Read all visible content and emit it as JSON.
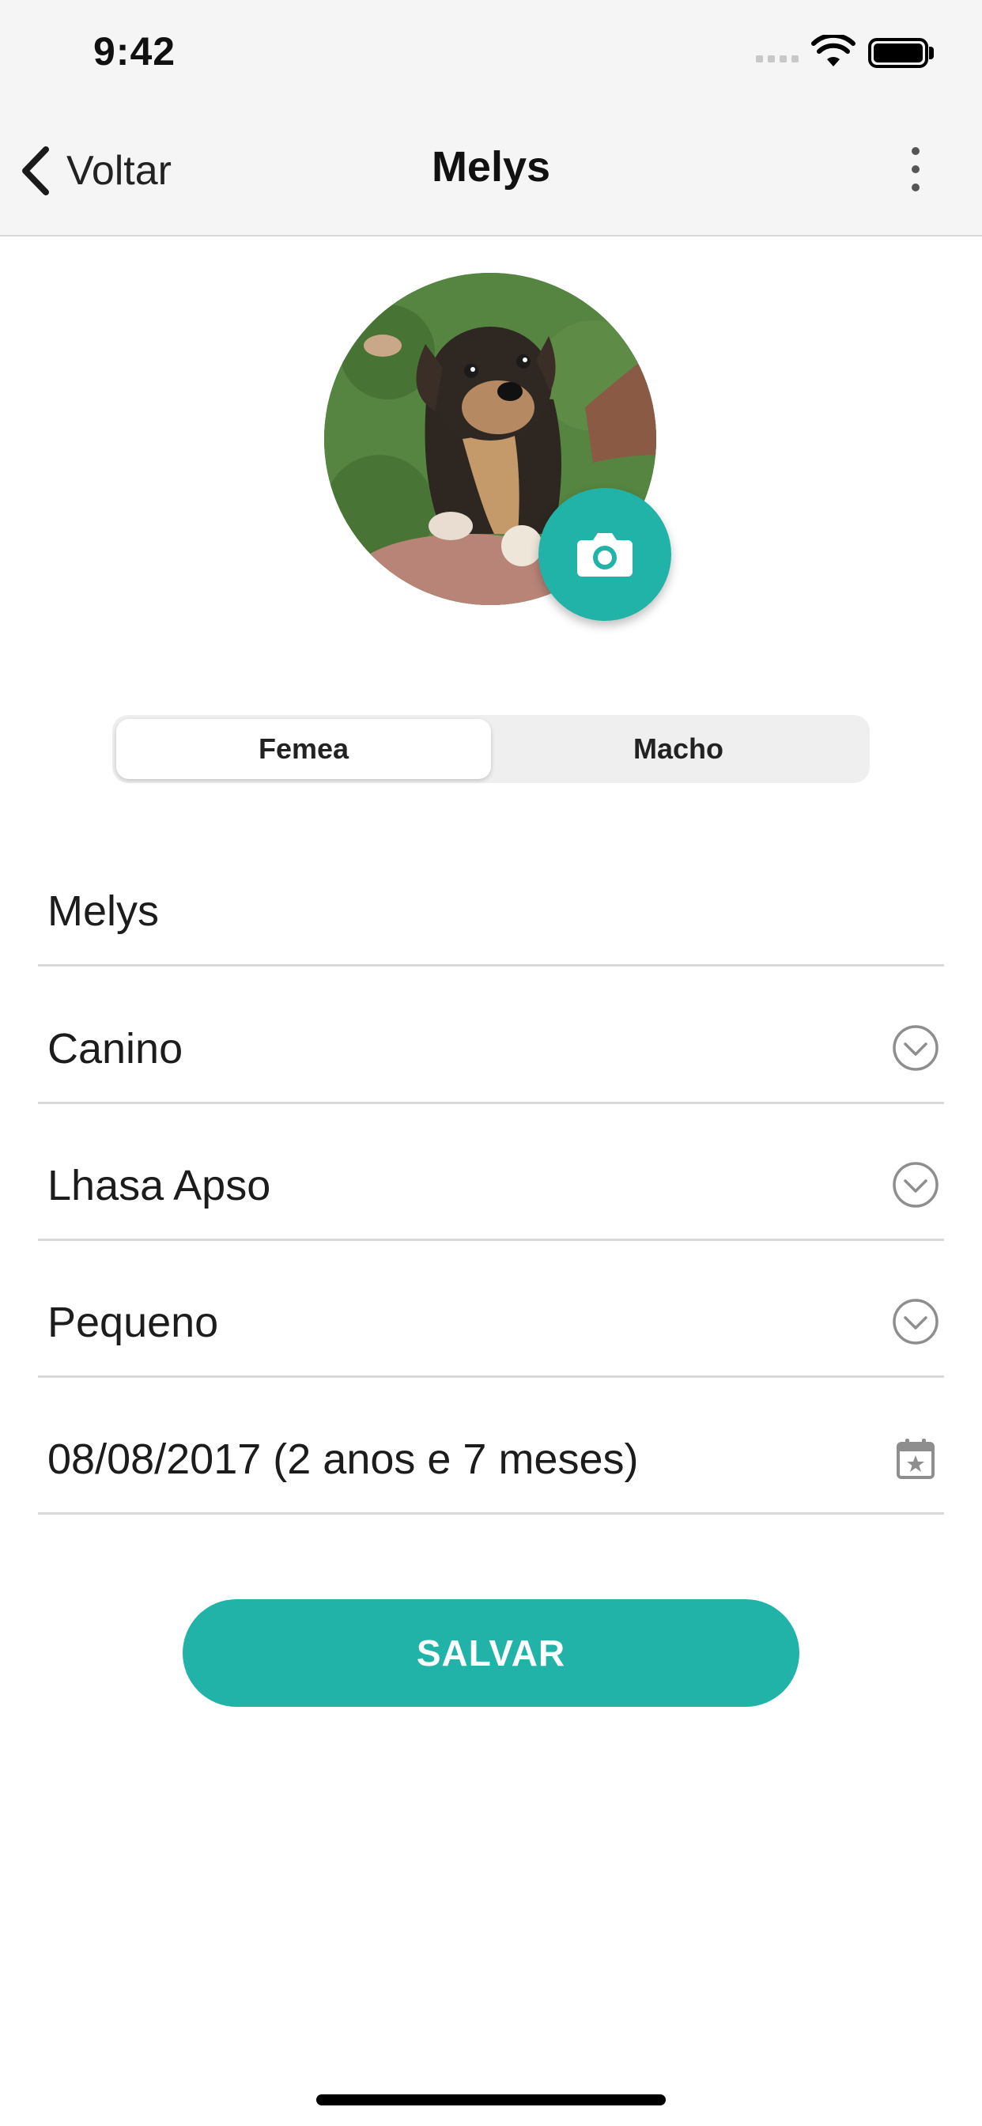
{
  "status_bar": {
    "time": "9:42"
  },
  "nav": {
    "back_label": "Voltar",
    "title": "Melys"
  },
  "gender": {
    "options": [
      "Femea",
      "Macho"
    ],
    "selected": "Femea"
  },
  "fields": {
    "name": "Melys",
    "species": "Canino",
    "breed": "Lhasa Apso",
    "size": "Pequeno",
    "birthdate": "08/08/2017 (2 anos e 7 meses)"
  },
  "save_label": "SALVAR",
  "icons": {
    "back": "chevron-left-icon",
    "more": "more-vertical-icon",
    "camera": "camera-icon",
    "dropdown": "chevron-down-circle-icon",
    "calendar": "calendar-star-icon"
  },
  "colors": {
    "accent": "#22b3a8",
    "header_bg": "#f5f5f5",
    "divider": "#d9d9d9"
  }
}
